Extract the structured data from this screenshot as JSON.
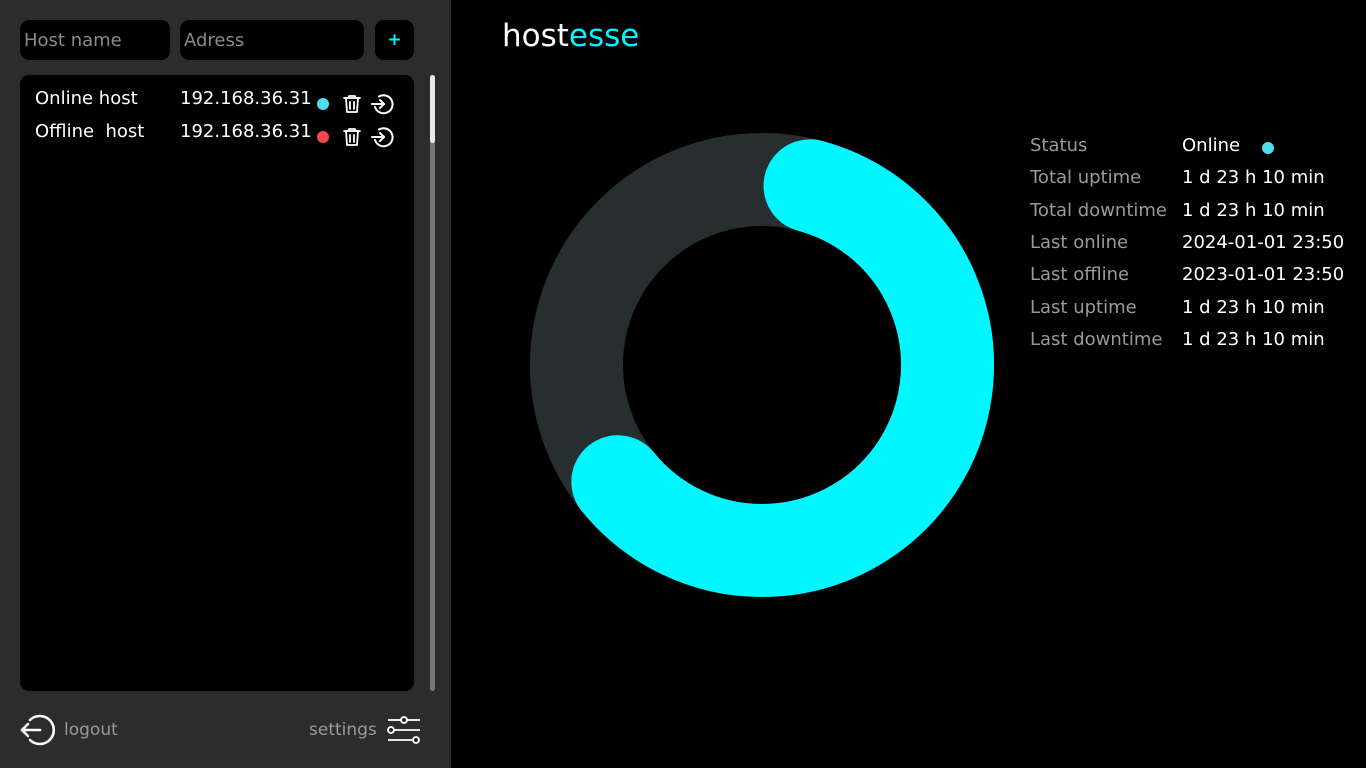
{
  "sidebar": {
    "host_name_placeholder": "Host name",
    "address_placeholder": "Adress",
    "add_label": "+",
    "hosts": [
      {
        "name": "Online host",
        "address": "192.168.36.31",
        "status_color": "#4fdcec"
      },
      {
        "name": "Offline  host",
        "address": "192.168.36.31",
        "status_color": "#f2484c"
      }
    ],
    "logout_label": "logout",
    "settings_label": "settings"
  },
  "brand": {
    "part1": "host",
    "part2": "esse"
  },
  "uptime": {
    "fraction": 0.6,
    "color": "#00f7ff",
    "track_color": "#272e30"
  },
  "stats": {
    "status_label": "Status",
    "status_value": "Online",
    "status_color": "#4fdcec",
    "rows": [
      {
        "label": "Total uptime",
        "value": "1 d 23 h 10 min"
      },
      {
        "label": "Total downtime",
        "value": "1 d 23 h 10 min"
      },
      {
        "label": "Last online",
        "value": "2024-01-01 23:50"
      },
      {
        "label": "Last offline",
        "value": "2023-01-01 23:50"
      },
      {
        "label": "Last uptime",
        "value": "1 d 23 h 10 min"
      },
      {
        "label": "Last downtime",
        "value": "1 d 23 h 10 min"
      }
    ]
  }
}
